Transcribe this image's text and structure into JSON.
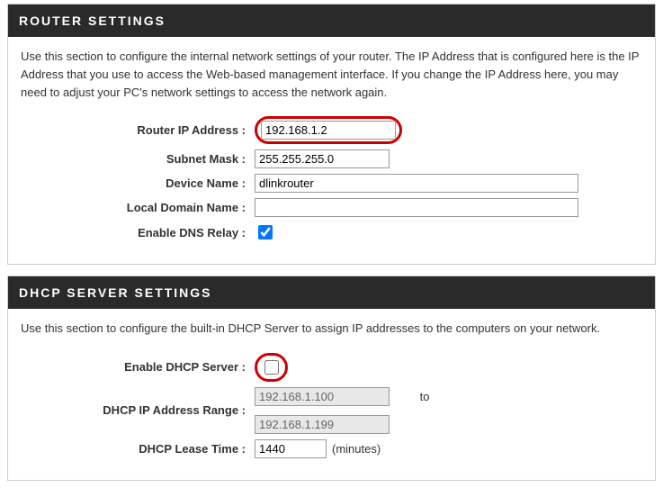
{
  "router": {
    "header": "ROUTER SETTINGS",
    "desc": "Use this section to configure the internal network settings of your router. The IP Address that is configured here is the IP Address that you use to access the Web-based management interface. If you change the IP Address here, you may need to adjust your PC's network settings to access the network again.",
    "ip_label": "Router IP Address :",
    "ip_value": "192.168.1.2",
    "subnet_label": "Subnet Mask :",
    "subnet_value": "255.255.255.0",
    "device_label": "Device Name :",
    "device_value": "dlinkrouter",
    "domain_label": "Local Domain Name :",
    "domain_value": "",
    "dns_label": "Enable DNS Relay :"
  },
  "dhcp": {
    "header": "DHCP SERVER SETTINGS",
    "desc": "Use this section to configure the built-in DHCP Server to assign IP addresses to the computers on your network.",
    "enable_label": "Enable DHCP Server :",
    "range_label": "DHCP IP Address Range :",
    "range_start": "192.168.1.100",
    "range_end": "192.168.1.199",
    "range_to": "to",
    "lease_label": "DHCP Lease Time :",
    "lease_value": "1440",
    "lease_unit": "(minutes)"
  }
}
